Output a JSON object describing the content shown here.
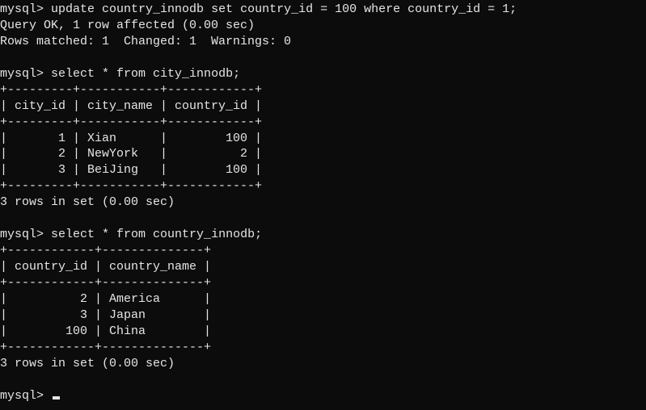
{
  "prompt": "mysql>",
  "cmd1": "update country_innodb set country_id = 100 where country_id = 1;",
  "resp1_line1": "Query OK, 1 row affected (0.00 sec)",
  "resp1_line2": "Rows matched: 1  Changed: 1  Warnings: 0",
  "cmd2": "select * from city_innodb;",
  "table1": {
    "border": "+---------+-----------+------------+",
    "header": "| city_id | city_name | country_id |",
    "rows": [
      "|       1 | Xian      |        100 |",
      "|       2 | NewYork   |          2 |",
      "|       3 | BeiJing   |        100 |"
    ]
  },
  "status1": "3 rows in set (0.00 sec)",
  "cmd3": "select * from country_innodb;",
  "table2": {
    "border": "+------------+--------------+",
    "header": "| country_id | country_name |",
    "rows": [
      "|          2 | America      |",
      "|          3 | Japan        |",
      "|        100 | China        |"
    ]
  },
  "status2": "3 rows in set (0.00 sec)",
  "chart_data": [
    {
      "type": "table",
      "title": "city_innodb",
      "columns": [
        "city_id",
        "city_name",
        "country_id"
      ],
      "rows": [
        [
          1,
          "Xian",
          100
        ],
        [
          2,
          "NewYork",
          2
        ],
        [
          3,
          "BeiJing",
          100
        ]
      ]
    },
    {
      "type": "table",
      "title": "country_innodb",
      "columns": [
        "country_id",
        "country_name"
      ],
      "rows": [
        [
          2,
          "America"
        ],
        [
          3,
          "Japan"
        ],
        [
          100,
          "China"
        ]
      ]
    }
  ]
}
